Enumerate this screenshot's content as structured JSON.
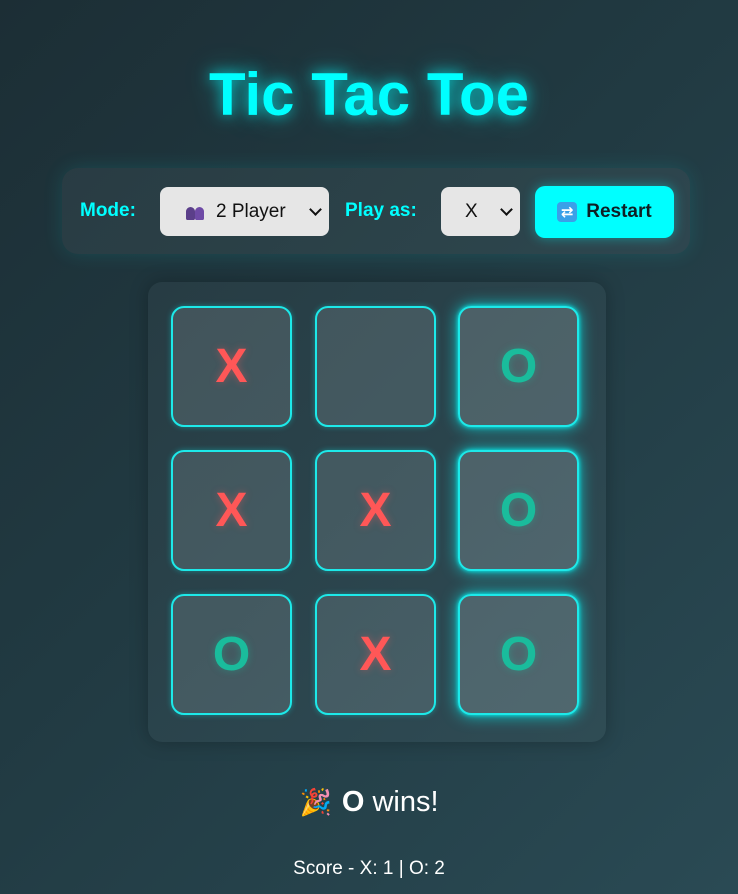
{
  "title": "Tic Tac Toe",
  "controls": {
    "mode_label": "Mode:",
    "mode_icon": "two-people-icon",
    "mode_value": "2 Player",
    "play_as_label": "Play as:",
    "play_as_value": "X",
    "restart_icon": "repeat-icon",
    "restart_label": "Restart"
  },
  "board": {
    "cells": [
      "X",
      "",
      "O",
      "X",
      "X",
      "O",
      "O",
      "X",
      "O"
    ],
    "winning_cells": [
      2,
      5,
      8
    ]
  },
  "status": {
    "icon": "party-popper-icon",
    "winner": "O",
    "text": "wins!"
  },
  "score": "Score - X: 1 | O: 2",
  "colors": {
    "accent": "#00ffff",
    "x_mark": "#ff5757",
    "o_mark": "#1abc9c"
  }
}
